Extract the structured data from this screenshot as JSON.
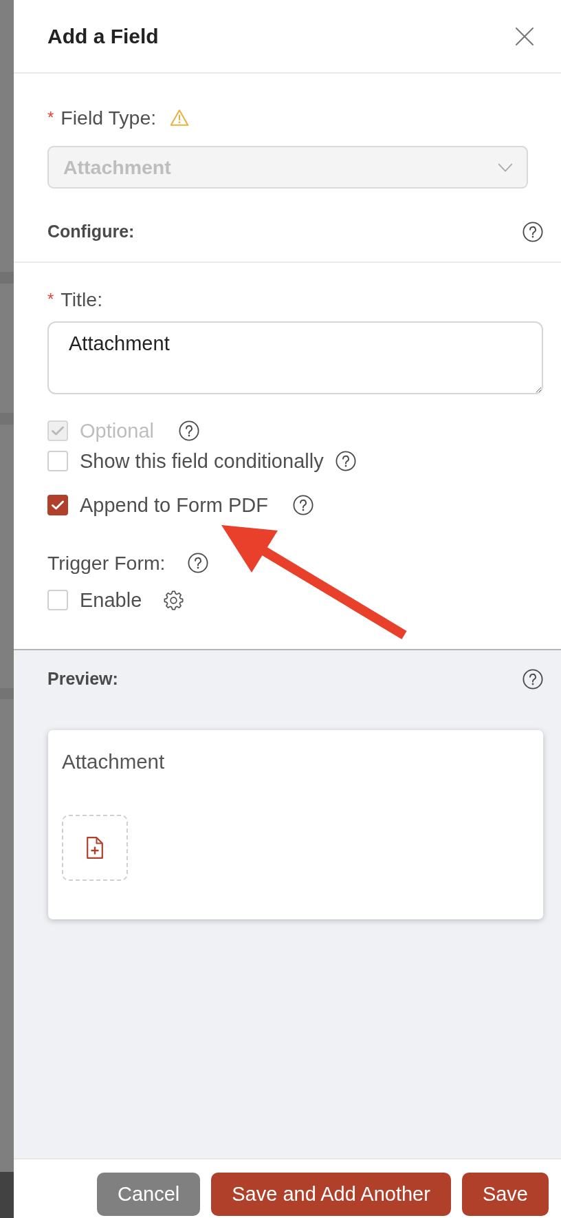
{
  "dialog": {
    "title": "Add a Field"
  },
  "field_type": {
    "required_mark": "*",
    "label": "Field Type:",
    "warning": true,
    "value": "Attachment",
    "disabled": true
  },
  "configure": {
    "heading": "Configure:",
    "help": true
  },
  "title_field": {
    "required_mark": "*",
    "label": "Title:",
    "value": "Attachment"
  },
  "options": [
    {
      "label": "Optional",
      "checked": true,
      "disabled": true,
      "help": true
    },
    {
      "label": "Show this field conditionally",
      "checked": false,
      "disabled": false,
      "help": true
    },
    {
      "label": "Append to Form PDF",
      "checked": true,
      "disabled": false,
      "help": true
    }
  ],
  "trigger_form": {
    "label": "Trigger Form:",
    "help": true,
    "option": {
      "label": "Enable",
      "checked": false,
      "settings_icon": true
    }
  },
  "preview": {
    "heading": "Preview:",
    "help": true,
    "field_label": "Attachment"
  },
  "buttons": [
    {
      "label": "Cancel",
      "kind": "secondary"
    },
    {
      "label": "Save and Add Another",
      "kind": "primary"
    },
    {
      "label": "Save",
      "kind": "primary"
    }
  ]
}
